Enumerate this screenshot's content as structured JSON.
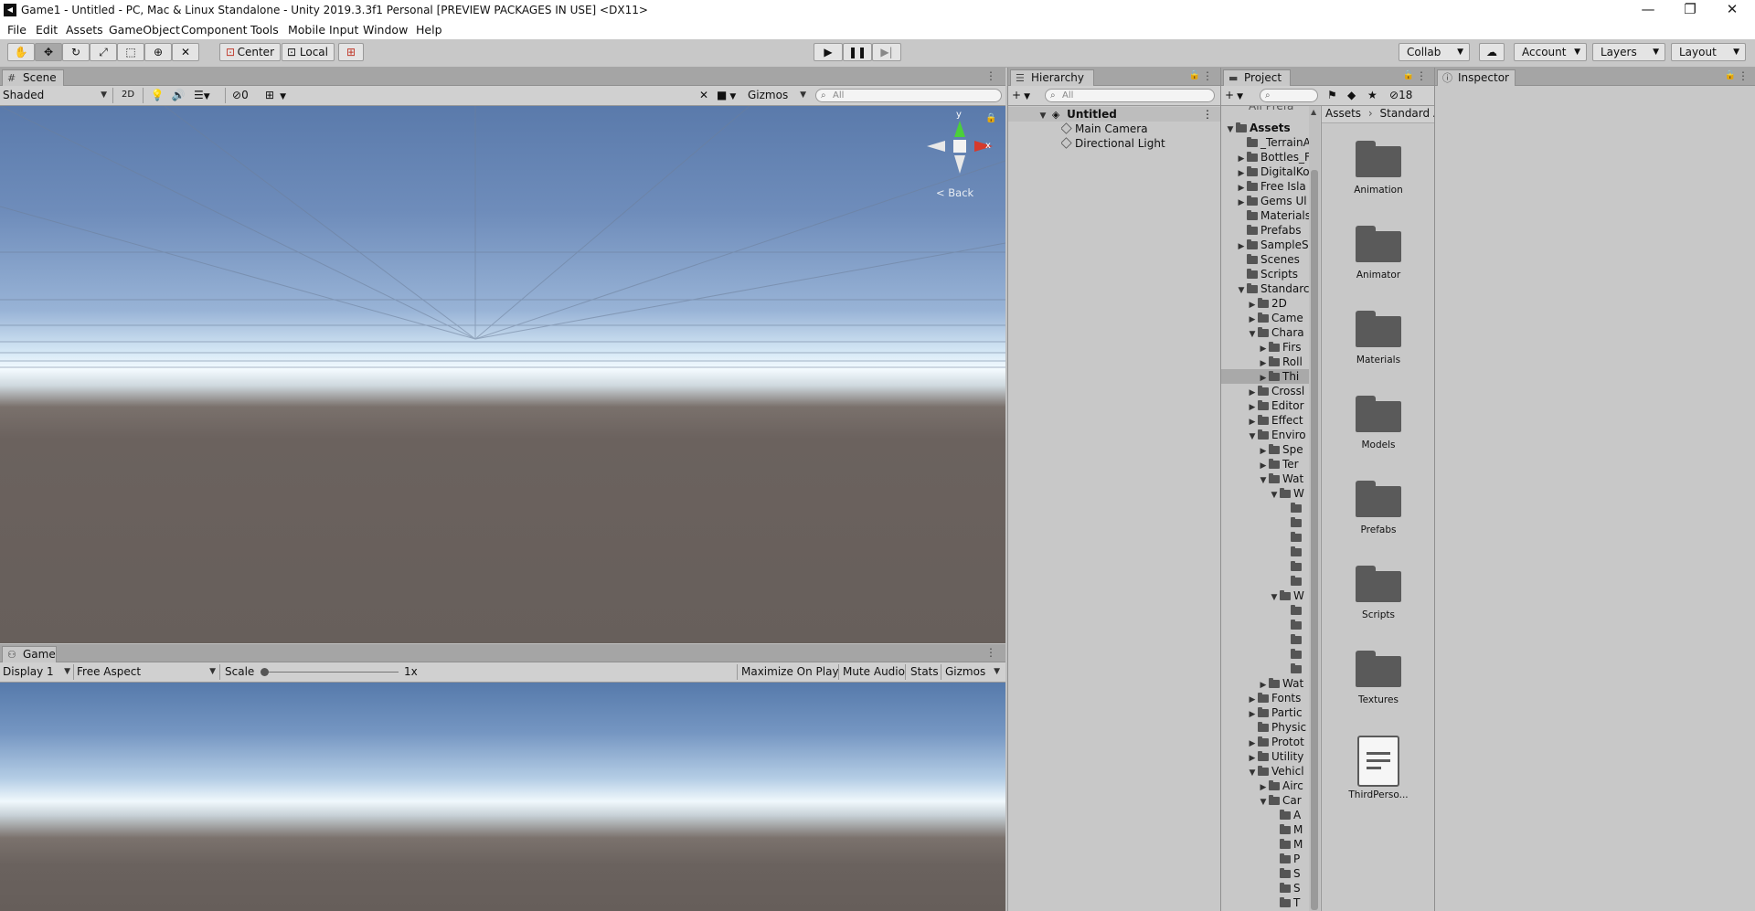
{
  "window": {
    "title": "Game1 - Untitled - PC, Mac & Linux Standalone - Unity 2019.3.3f1 Personal [PREVIEW PACKAGES IN USE] <DX11>",
    "minimize": "—",
    "restore": "❐",
    "close": "✕"
  },
  "menu": [
    "File",
    "Edit",
    "Assets",
    "GameObject",
    "Component",
    "Tools",
    "Mobile Input",
    "Window",
    "Help"
  ],
  "toolbar": {
    "pivot_label": "Center",
    "space_label": "Local",
    "collab_label": "Collab",
    "account_label": "Account",
    "layers_label": "Layers",
    "layout_label": "Layout"
  },
  "scene": {
    "tab_label": "Scene",
    "shading_mode": "Shaded",
    "mode_2d": "2D",
    "hidden_count": "0",
    "gizmos_label": "Gizmos",
    "search_placeholder": "All",
    "gizmo_y": "y",
    "gizmo_x": "x",
    "gizmo_view": "< Back"
  },
  "game": {
    "tab_label": "Game",
    "display": "Display 1",
    "aspect": "Free Aspect",
    "scale_label": "Scale",
    "scale_value": "1x",
    "maximize_label": "Maximize On Play",
    "mute_label": "Mute Audio",
    "stats_label": "Stats",
    "gizmos_label": "Gizmos"
  },
  "hierarchy": {
    "tab_label": "Hierarchy",
    "search_placeholder": "All",
    "scene_name": "Untitled",
    "objects": [
      "Main Camera",
      "Directional Light"
    ]
  },
  "project": {
    "tab_label": "Project",
    "hidden_packages_count": "18",
    "breadcrumb": [
      "Assets",
      "Standard A"
    ],
    "tree_top_clipped": "All Prefa",
    "tree": [
      {
        "label": "Assets",
        "depth": 0,
        "arrow": "down",
        "bold": true
      },
      {
        "label": "_TerrainA",
        "depth": 1,
        "arrow": "none"
      },
      {
        "label": "Bottles_F",
        "depth": 1,
        "arrow": "right"
      },
      {
        "label": "DigitalKo",
        "depth": 1,
        "arrow": "right"
      },
      {
        "label": "Free Isla",
        "depth": 1,
        "arrow": "right"
      },
      {
        "label": "Gems Ul",
        "depth": 1,
        "arrow": "right"
      },
      {
        "label": "Materials",
        "depth": 1,
        "arrow": "none"
      },
      {
        "label": "Prefabs",
        "depth": 1,
        "arrow": "none"
      },
      {
        "label": "SampleS",
        "depth": 1,
        "arrow": "right"
      },
      {
        "label": "Scenes",
        "depth": 1,
        "arrow": "none"
      },
      {
        "label": "Scripts",
        "depth": 1,
        "arrow": "none"
      },
      {
        "label": "Standarc",
        "depth": 1,
        "arrow": "down"
      },
      {
        "label": "2D",
        "depth": 2,
        "arrow": "right"
      },
      {
        "label": "Came",
        "depth": 2,
        "arrow": "right"
      },
      {
        "label": "Chara",
        "depth": 2,
        "arrow": "down"
      },
      {
        "label": "Firs",
        "depth": 3,
        "arrow": "right"
      },
      {
        "label": "Roll",
        "depth": 3,
        "arrow": "right"
      },
      {
        "label": "Thi",
        "depth": 3,
        "arrow": "right",
        "selected": true
      },
      {
        "label": "Crossl",
        "depth": 2,
        "arrow": "right"
      },
      {
        "label": "Editor",
        "depth": 2,
        "arrow": "right"
      },
      {
        "label": "Effect",
        "depth": 2,
        "arrow": "right"
      },
      {
        "label": "Enviro",
        "depth": 2,
        "arrow": "down"
      },
      {
        "label": "Spe",
        "depth": 3,
        "arrow": "right"
      },
      {
        "label": "Ter",
        "depth": 3,
        "arrow": "right"
      },
      {
        "label": "Wat",
        "depth": 3,
        "arrow": "down"
      },
      {
        "label": "W",
        "depth": 4,
        "arrow": "down"
      },
      {
        "label": "",
        "depth": 5,
        "arrow": "none"
      },
      {
        "label": "",
        "depth": 5,
        "arrow": "none"
      },
      {
        "label": "",
        "depth": 5,
        "arrow": "none"
      },
      {
        "label": "",
        "depth": 5,
        "arrow": "none"
      },
      {
        "label": "",
        "depth": 5,
        "arrow": "none"
      },
      {
        "label": "",
        "depth": 5,
        "arrow": "none"
      },
      {
        "label": "W",
        "depth": 4,
        "arrow": "down"
      },
      {
        "label": "",
        "depth": 5,
        "arrow": "none"
      },
      {
        "label": "",
        "depth": 5,
        "arrow": "none"
      },
      {
        "label": "",
        "depth": 5,
        "arrow": "none"
      },
      {
        "label": "",
        "depth": 5,
        "arrow": "none"
      },
      {
        "label": "",
        "depth": 5,
        "arrow": "none"
      },
      {
        "label": "Wat",
        "depth": 3,
        "arrow": "right"
      },
      {
        "label": "Fonts",
        "depth": 2,
        "arrow": "right"
      },
      {
        "label": "Partic",
        "depth": 2,
        "arrow": "right"
      },
      {
        "label": "Physic",
        "depth": 2,
        "arrow": "none"
      },
      {
        "label": "Protot",
        "depth": 2,
        "arrow": "right"
      },
      {
        "label": "Utility",
        "depth": 2,
        "arrow": "right"
      },
      {
        "label": "Vehicl",
        "depth": 2,
        "arrow": "down"
      },
      {
        "label": "Airc",
        "depth": 3,
        "arrow": "right"
      },
      {
        "label": "Car",
        "depth": 3,
        "arrow": "down"
      },
      {
        "label": "A",
        "depth": 4,
        "arrow": "none"
      },
      {
        "label": "M",
        "depth": 4,
        "arrow": "none"
      },
      {
        "label": "M",
        "depth": 4,
        "arrow": "none"
      },
      {
        "label": "P",
        "depth": 4,
        "arrow": "none"
      },
      {
        "label": "S",
        "depth": 4,
        "arrow": "none"
      },
      {
        "label": "S",
        "depth": 4,
        "arrow": "none"
      },
      {
        "label": "T",
        "depth": 4,
        "arrow": "none"
      }
    ],
    "grid_items": [
      {
        "label": "Animation",
        "kind": "folder"
      },
      {
        "label": "Animator",
        "kind": "folder"
      },
      {
        "label": "Materials",
        "kind": "folder"
      },
      {
        "label": "Models",
        "kind": "folder"
      },
      {
        "label": "Prefabs",
        "kind": "folder"
      },
      {
        "label": "Scripts",
        "kind": "folder"
      },
      {
        "label": "Textures",
        "kind": "folder"
      },
      {
        "label": "ThirdPerso...",
        "kind": "file"
      }
    ]
  },
  "inspector": {
    "tab_label": "Inspector"
  },
  "colors": {
    "sky_top": "#5f7fae",
    "horizon": "#f4fbff",
    "ground": "#6a625e",
    "gizmo_y": "#4bd03a",
    "gizmo_x": "#d53a2c"
  }
}
